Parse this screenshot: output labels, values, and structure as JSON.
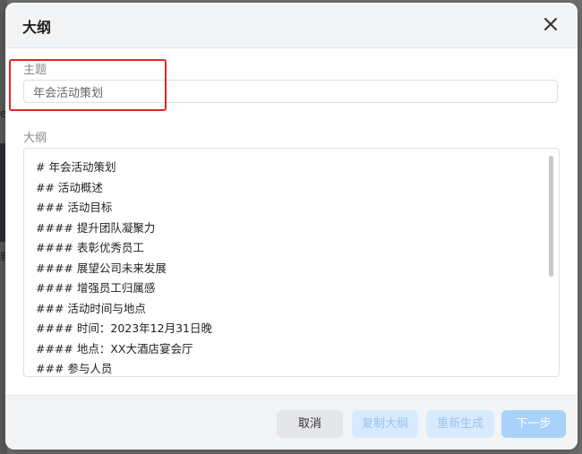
{
  "dialog": {
    "title": "大纲",
    "close_icon": "close-icon"
  },
  "topic": {
    "label": "主题",
    "value": "年会活动策划"
  },
  "outline": {
    "label": "大纲",
    "lines": [
      "# 年会活动策划",
      "## 活动概述",
      "### 活动目标",
      "#### 提升团队凝聚力",
      "#### 表彰优秀员工",
      "#### 展望公司未来发展",
      "#### 增强员工归属感",
      "### 活动时间与地点",
      "#### 时间：2023年12月31日晚",
      "#### 地点：XX大酒店宴会厅",
      "### 参与人员"
    ]
  },
  "footer": {
    "cancel_label": "取消",
    "copy_label": "复制大纲",
    "regenerate_label": "重新生成",
    "next_label": "下一步"
  },
  "colors": {
    "highlight": "#e02424",
    "primary_disabled": "#a8d2fb",
    "secondary_disabled": "#d7eaff"
  }
}
